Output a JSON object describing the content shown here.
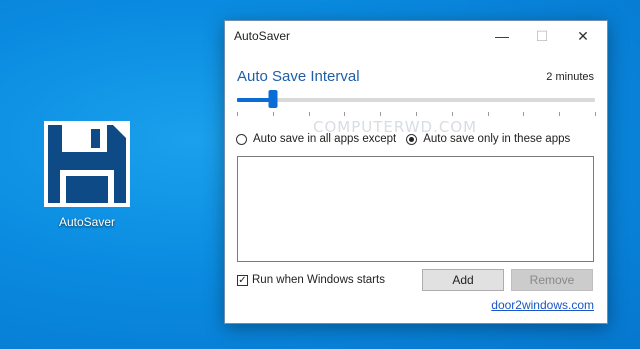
{
  "desktop": {
    "icon_label": "AutoSaver",
    "icon": "floppy-disk-icon"
  },
  "window": {
    "title": "AutoSaver",
    "controls": {
      "minimize": "—",
      "maximize": "☐",
      "close": "✕"
    },
    "interval": {
      "title": "Auto Save Interval",
      "value_text": "2 minutes",
      "slider_fraction": 0.1,
      "tick_count": 10
    },
    "watermark": "COMPUTERWD.COM",
    "mode_options": [
      {
        "label": "Auto save in all apps except",
        "checked": false
      },
      {
        "label": "Auto save only in these apps",
        "checked": true
      }
    ],
    "run_on_startup": {
      "label": "Run when Windows starts",
      "checked": true
    },
    "buttons": {
      "add": "Add",
      "remove": "Remove"
    },
    "link": "door2windows.com"
  },
  "colors": {
    "accent": "#0a6cd6",
    "heading": "#1f5fa8",
    "desktop_bg": "#0a8be0"
  }
}
